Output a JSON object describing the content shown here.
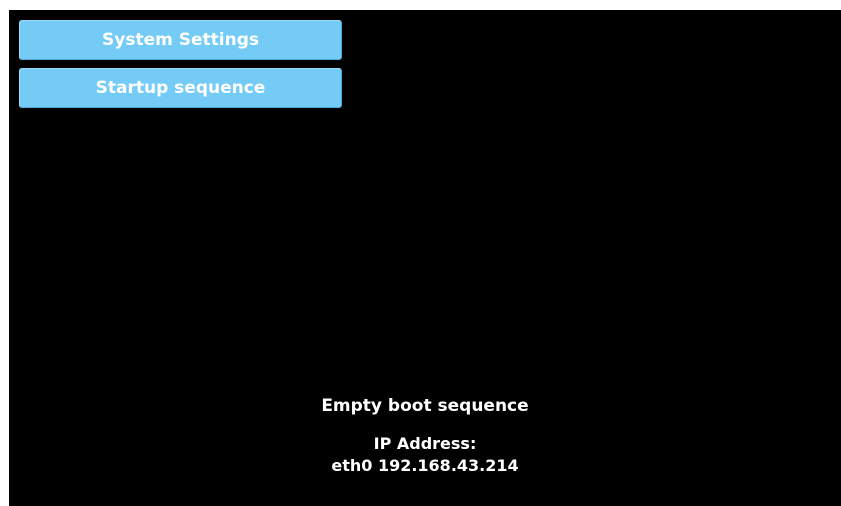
{
  "menu": {
    "system_settings_label": "System Settings",
    "startup_sequence_label": "Startup sequence"
  },
  "status": {
    "boot_message": "Empty boot sequence",
    "ip_label": "IP Address:",
    "ip_value": "eth0 192.168.43.214"
  },
  "colors": {
    "background": "#000000",
    "button": "#74ccf6",
    "text": "#ffffff"
  }
}
